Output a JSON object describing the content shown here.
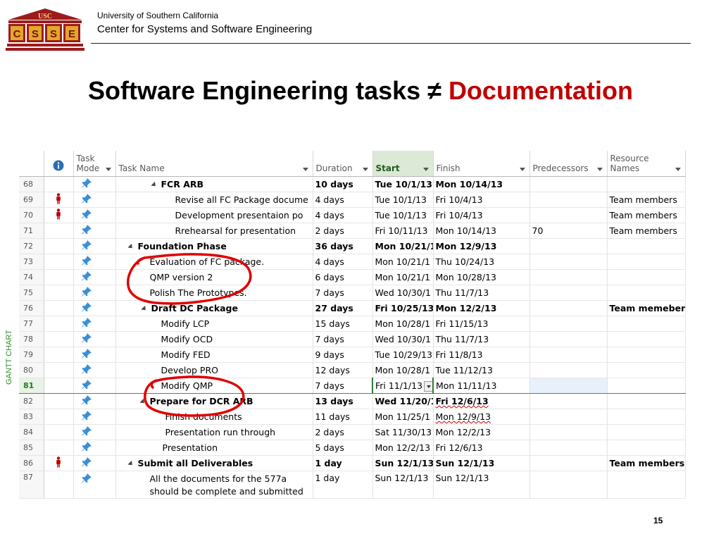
{
  "header": {
    "logo_top": "USC",
    "logo_letters": [
      "C",
      "S",
      "S",
      "E"
    ],
    "university": "University of Southern California",
    "center": "Center for Systems and Software Engineering"
  },
  "title": {
    "prefix": "Software Engineering tasks ≠ ",
    "highlight": "Documentation"
  },
  "side_label": "GANTT CHART",
  "table": {
    "columns": {
      "mode": "Task Mode",
      "name": "Task Name",
      "duration": "Duration",
      "start": "Start",
      "finish": "Finish",
      "pred": "Predecessors",
      "resource": "Resource Names"
    },
    "rows": [
      {
        "id": "68",
        "name": "FCR ARB",
        "duration": "10 days",
        "start": "Tue 10/1/13",
        "finish": "Mon 10/14/13",
        "pred": "",
        "resource": ""
      },
      {
        "id": "69",
        "name": "Revise all FC Package docume",
        "duration": "4 days",
        "start": "Tue 10/1/13",
        "finish": "Fri 10/4/13",
        "pred": "",
        "resource": "Team members"
      },
      {
        "id": "70",
        "name": "Development presentaion po",
        "duration": "4 days",
        "start": "Tue 10/1/13",
        "finish": "Fri 10/4/13",
        "pred": "",
        "resource": "Team members"
      },
      {
        "id": "71",
        "name": "Rrehearsal for presentation",
        "duration": "2 days",
        "start": "Fri 10/11/13",
        "finish": "Mon 10/14/13",
        "pred": "70",
        "resource": "Team members"
      },
      {
        "id": "72",
        "name": "Foundation Phase",
        "duration": "36 days",
        "start": "Mon 10/21/1",
        "finish": "Mon 12/9/13",
        "pred": "",
        "resource": ""
      },
      {
        "id": "73",
        "name": "Evaluation of  FC package.",
        "duration": "4 days",
        "start": "Mon 10/21/1",
        "finish": "Thu 10/24/13",
        "pred": "",
        "resource": ""
      },
      {
        "id": "74",
        "name": "QMP version 2",
        "duration": "6 days",
        "start": "Mon 10/21/1",
        "finish": "Mon 10/28/13",
        "pred": "",
        "resource": ""
      },
      {
        "id": "75",
        "name": "Polish The Prototypes.",
        "duration": "7 days",
        "start": "Wed 10/30/1",
        "finish": "Thu 11/7/13",
        "pred": "",
        "resource": ""
      },
      {
        "id": "76",
        "name": "Draft DC Package",
        "duration": "27 days",
        "start": "Fri 10/25/13",
        "finish": "Mon 12/2/13",
        "pred": "",
        "resource": "Team memebers"
      },
      {
        "id": "77",
        "name": "Modify LCP",
        "duration": "15 days",
        "start": "Mon 10/28/1",
        "finish": "Fri 11/15/13",
        "pred": "",
        "resource": ""
      },
      {
        "id": "78",
        "name": "Modify OCD",
        "duration": "7 days",
        "start": "Wed 10/30/1",
        "finish": "Thu 11/7/13",
        "pred": "",
        "resource": ""
      },
      {
        "id": "79",
        "name": "Modify FED",
        "duration": "9 days",
        "start": "Tue 10/29/13",
        "finish": "Fri 11/8/13",
        "pred": "",
        "resource": ""
      },
      {
        "id": "80",
        "name": "Develop PRO",
        "duration": "12 days",
        "start": "Mon 10/28/1",
        "finish": "Tue 11/12/13",
        "pred": "",
        "resource": ""
      },
      {
        "id": "81",
        "name": "Modify QMP",
        "duration": "7 days",
        "start": "Fri 11/1/13",
        "finish": "Mon 11/11/13",
        "pred": "",
        "resource": ""
      },
      {
        "id": "82",
        "name": "Prepare for DCR ARB",
        "duration": "13 days",
        "start": "Wed 11/20/1",
        "finish": "Fri 12/6/13",
        "pred": "",
        "resource": ""
      },
      {
        "id": "83",
        "name": "Finish documents",
        "duration": "11 days",
        "start": "Mon 11/25/1",
        "finish": "Mon 12/9/13",
        "pred": "",
        "resource": ""
      },
      {
        "id": "84",
        "name": "Presentation run through",
        "duration": "2 days",
        "start": "Sat 11/30/13",
        "finish": "Mon 12/2/13",
        "pred": "",
        "resource": ""
      },
      {
        "id": "85",
        "name": "Presentation",
        "duration": "5 days",
        "start": "Mon 12/2/13",
        "finish": "Fri 12/6/13",
        "pred": "",
        "resource": ""
      },
      {
        "id": "86",
        "name": "Submit all Deliverables",
        "duration": "1 day",
        "start": "Sun 12/1/13",
        "finish": "Sun 12/1/13",
        "pred": "",
        "resource": "Team members"
      },
      {
        "id": "87",
        "name": "All the documents for the 577a should be complete and submitted",
        "duration": "1 day",
        "start": "Sun 12/1/13",
        "finish": "Sun 12/1/13",
        "pred": "",
        "resource": ""
      }
    ]
  },
  "colors": {
    "accent_red": "#c00000",
    "logo_red": "#9b1c1c",
    "logo_gold": "#e2a82a",
    "pin_blue": "#3a8fd6",
    "selection_green": "#2e7d32",
    "annotation_red": "#e00000"
  },
  "icons": {
    "info": "info-icon",
    "task_mode": "pushpin-icon",
    "resource_indicator": "person-icon"
  },
  "page_number": "15"
}
